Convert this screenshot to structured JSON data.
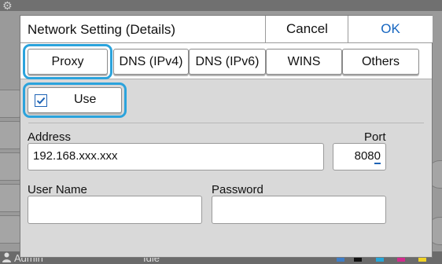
{
  "dialog": {
    "title": "Network Setting (Details)",
    "cancel_label": "Cancel",
    "ok_label": "OK"
  },
  "tabs": [
    {
      "label": "Proxy",
      "selected": true
    },
    {
      "label": "DNS (IPv4)",
      "selected": false
    },
    {
      "label": "DNS (IPv6)",
      "selected": false
    },
    {
      "label": "WINS",
      "selected": false
    },
    {
      "label": "Others",
      "selected": false
    }
  ],
  "use_checkbox": {
    "label": "Use",
    "checked": true
  },
  "fields": {
    "address_label": "Address",
    "address_value": "192.168.xxx.xxx",
    "port_label": "Port",
    "port_value_main": "808",
    "port_value_cursor": "0",
    "username_label": "User Name",
    "username_value": "",
    "password_label": "Password",
    "password_value": ""
  },
  "status_bar": {
    "user": "Admin",
    "state": "Idle",
    "toner": [
      "K",
      "C",
      "M",
      "Y"
    ]
  },
  "colors": {
    "accent_highlight": "#2ba3dc",
    "ok_text": "#1565c0",
    "checkbox": "#1e63b5"
  },
  "icons": [
    "gear-icon",
    "checkmark-icon",
    "user-icon"
  ]
}
